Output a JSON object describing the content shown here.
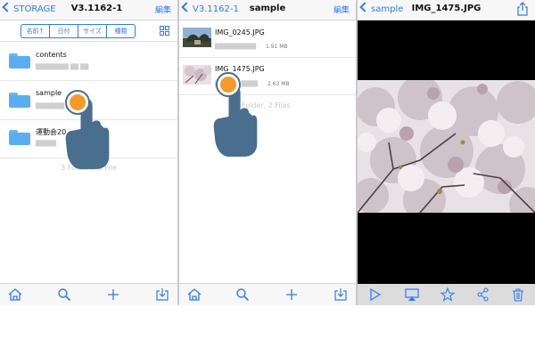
{
  "screen1": {
    "back_label": "STORAGE",
    "title": "V3.1162-1",
    "edit_label": "編集",
    "sort_options": [
      "名前↑",
      "日付",
      "サイズ",
      "種類"
    ],
    "items": [
      {
        "name": "contents",
        "type": "folder"
      },
      {
        "name": "sample",
        "type": "folder"
      },
      {
        "name": "運動会20",
        "type": "folder"
      }
    ],
    "summary": "3 Folders, 0 File"
  },
  "screen2": {
    "back_label": "V3.1162-1",
    "title": "sample",
    "edit_label": "編集",
    "items": [
      {
        "name": "IMG_0245.JPG",
        "size": "1.91 MB"
      },
      {
        "name": "IMG_1475.JPG",
        "size": "2.63 MB"
      }
    ],
    "summary": "Folder, 2 Files"
  },
  "screen3": {
    "back_label": "sample",
    "title": "IMG_1475.JPG"
  },
  "tabbar_icons": [
    "home-icon",
    "search-icon",
    "plus-icon",
    "import-icon"
  ],
  "viewer_toolbar_icons": [
    "play-icon",
    "airplay-icon",
    "star-icon",
    "share-icon",
    "trash-icon"
  ],
  "colors": {
    "accent": "#2f7bf6",
    "folder": "#5aaef0",
    "tap_marker": "#f39a2b",
    "hand": "#4a6e8e"
  }
}
